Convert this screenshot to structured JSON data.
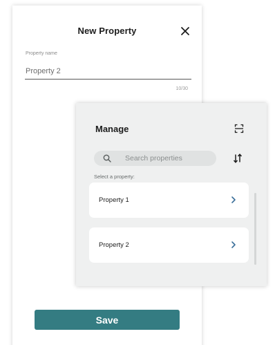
{
  "new_property": {
    "title": "New Property",
    "field_label": "Property name",
    "field_value": "Property 2",
    "counter": "10/30",
    "save_label": "Save",
    "accent_color": "#347c82"
  },
  "manage": {
    "title": "Manage",
    "search_placeholder": "Search properties",
    "select_label": "Select a property:",
    "items": [
      {
        "label": "Property 1"
      },
      {
        "label": "Property 2"
      }
    ],
    "chevron_color": "#3a6f9a"
  },
  "icons": {
    "close": "close-icon",
    "scan": "scan-icon",
    "search": "search-icon",
    "sort": "sort-icon",
    "chevron": "chevron-right-icon"
  }
}
